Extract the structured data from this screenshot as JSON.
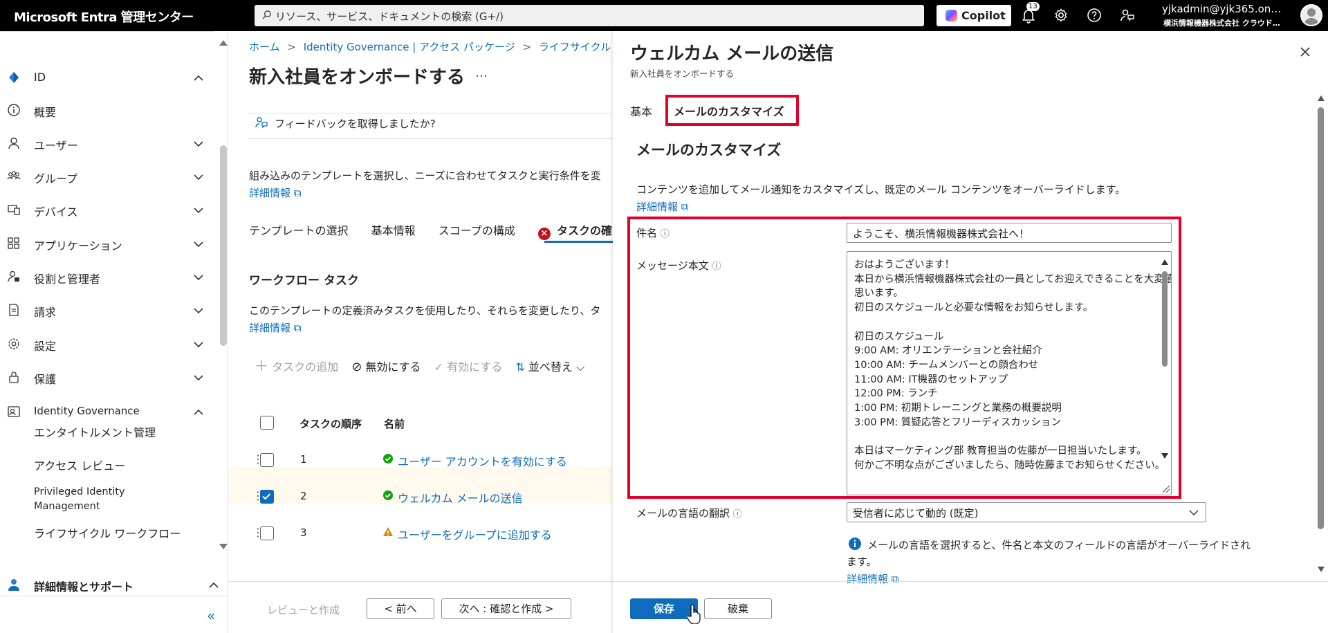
{
  "topbar": {
    "brand": "Microsoft Entra 管理センター",
    "search_placeholder": "リソース、サービス、ドキュメントの検索 (G+/)",
    "copilot_label": "Copilot",
    "notification_count": "13",
    "user_name": "yjkadmin@yjk365.on…",
    "user_org": "横浜情報機器株式会社 クラウド…"
  },
  "sidebar": {
    "items": [
      {
        "label": "ID",
        "icon": "diamond-icon"
      },
      {
        "label": "概要",
        "icon": "info-icon"
      },
      {
        "label": "ユーザー",
        "icon": "user-icon"
      },
      {
        "label": "グループ",
        "icon": "group-icon"
      },
      {
        "label": "デバイス",
        "icon": "device-icon"
      },
      {
        "label": "アプリケーション",
        "icon": "apps-icon"
      },
      {
        "label": "役割と管理者",
        "icon": "roles-icon"
      },
      {
        "label": "請求",
        "icon": "billing-icon"
      },
      {
        "label": "設定",
        "icon": "gear-icon"
      },
      {
        "label": "保護",
        "icon": "lock-icon"
      },
      {
        "label": "Identity Governance",
        "icon": "governance-icon"
      }
    ],
    "sub_items": [
      "エンタイトルメント管理",
      "アクセス レビュー",
      "Privileged Identity Management",
      "ライフサイクル ワークフロー"
    ],
    "support": "詳細情報とサポート",
    "collapse": "«"
  },
  "main": {
    "breadcrumb": [
      "ホーム",
      "Identity Governance | アクセス パッケージ",
      "ライフサイクル ワー…"
    ],
    "title": "新入社員をオンボードする",
    "more": "…",
    "feedback": "フィードバックを取得しましたか?",
    "description": "組み込みのテンプレートを選択し、ニーズに合わせてタスクと実行条件を変",
    "learn_more": "詳細情報",
    "tabs": [
      "テンプレートの選択",
      "基本情報",
      "スコープの構成",
      "タスクの確"
    ],
    "section_title": "ワークフロー タスク",
    "section_desc": "このテンプレートの定義済みタスクを使用したり、それらを変更したり、タ",
    "section_learn_more": "詳細情報",
    "toolbar": {
      "add": "タスクの追加",
      "disable": "無効にする",
      "enable": "有効にする",
      "sort": "並べ替え"
    },
    "table": {
      "headers": [
        "タスクの順序",
        "名前"
      ],
      "rows": [
        {
          "order": "1",
          "name": "ユーザー アカウントを有効にする",
          "status": "success",
          "checked": false
        },
        {
          "order": "2",
          "name": "ウェルカム メールの送信",
          "status": "success",
          "checked": true
        },
        {
          "order": "3",
          "name": "ユーザーをグループに追加する",
          "status": "warning",
          "checked": false
        }
      ]
    },
    "footer": {
      "review": "レビューと作成",
      "prev": "< 前へ",
      "next": "次へ : 確認と作成 >"
    }
  },
  "panel": {
    "title": "ウェルカム メールの送信",
    "subtitle": "新入社員をオンボードする",
    "tabs": [
      "基本",
      "メールのカスタマイズ"
    ],
    "section_title": "メールのカスタマイズ",
    "description": "コンテンツを追加してメール通知をカスタマイズし、既定のメール コンテンツをオーバーライドします。",
    "learn_more": "詳細情報",
    "subject_label": "件名",
    "subject_value": "ようこそ、横浜情報機器株式会社へ！",
    "body_label": "メッセージ本文",
    "body_lines": [
      "おはようございます！",
      "本日から横浜情報機器株式会社の一員としてお迎えできることを大変嬉しく",
      "思います。",
      "初日のスケジュールと必要な情報をお知らせします。",
      "",
      "初日のスケジュール",
      "9:00 AM: オリエンテーションと会社紹介",
      "10:00 AM: チームメンバーとの顔合わせ",
      "11:00 AM: IT機器のセットアップ",
      "12:00 PM: ランチ",
      "1:00 PM: 初期トレーニングと業務の概要説明",
      "3:00 PM: 質疑応答とフリーディスカッション",
      "",
      "本日はマーケティング部 教育担当の佐藤が一日担当いたします。",
      "何かご不明な点がございましたら、随時佐藤までお知らせください。"
    ],
    "language_label": "メールの言語の翻訳",
    "language_value": "受信者に応じて動的 (既定)",
    "language_info_1": "メールの言語を選択すると、件名と本文のフィールドの言語がオーバーライドされ",
    "language_info_2": "ます。",
    "language_learn_more": "詳細情報",
    "save": "保存",
    "discard": "破棄"
  },
  "colors": {
    "accent": "#0f6cbd",
    "highlight": "#e3002b",
    "success": "#13a10e",
    "warning": "#d48c00"
  }
}
